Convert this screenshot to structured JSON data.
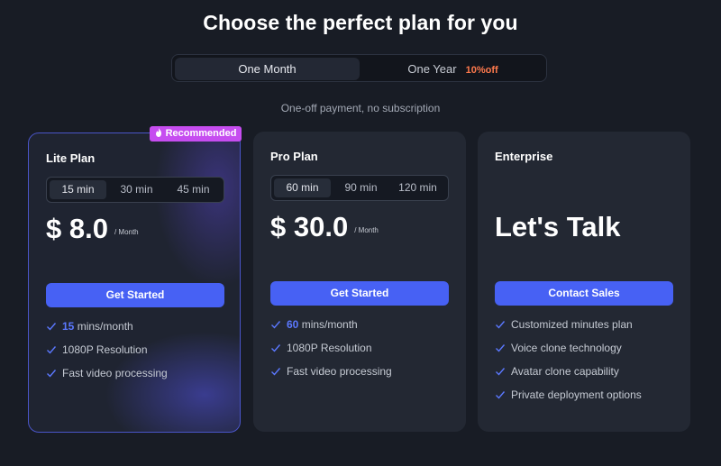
{
  "header": {
    "title": "Choose the perfect plan for you",
    "billing_toggle": {
      "month_label": "One Month",
      "year_label": "One Year",
      "year_discount": "10%off",
      "selected": "One Month"
    },
    "subtitle": "One-off payment, no subscription"
  },
  "colors": {
    "background": "#181c25",
    "card": "#232833",
    "accent_button": "#4761f4",
    "badge": "#c64df0",
    "discount": "#ff7a4d",
    "highlight": "#5b78ff"
  },
  "plans": [
    {
      "name": "Lite Plan",
      "badge": "Recommended",
      "badge_icon": "fire-icon",
      "durations": [
        "15 min",
        "30 min",
        "45 min"
      ],
      "selected_duration": "15 min",
      "price": "$ 8.0",
      "period": "/ Month",
      "cta": "Get Started",
      "features": [
        {
          "highlight": "15",
          "text": "mins/month"
        },
        {
          "text": "1080P Resolution"
        },
        {
          "text": "Fast video processing"
        }
      ]
    },
    {
      "name": "Pro Plan",
      "durations": [
        "60 min",
        "90 min",
        "120 min"
      ],
      "selected_duration": "60 min",
      "price": "$ 30.0",
      "period": "/ Month",
      "cta": "Get Started",
      "features": [
        {
          "highlight": "60",
          "text": "mins/month"
        },
        {
          "text": "1080P Resolution"
        },
        {
          "text": "Fast video processing"
        }
      ]
    },
    {
      "name": "Enterprise",
      "headline": "Let's Talk",
      "cta": "Contact Sales",
      "features": [
        {
          "text": "Customized minutes plan"
        },
        {
          "text": "Voice clone technology"
        },
        {
          "text": "Avatar clone capability"
        },
        {
          "text": "Private deployment options"
        }
      ]
    }
  ]
}
